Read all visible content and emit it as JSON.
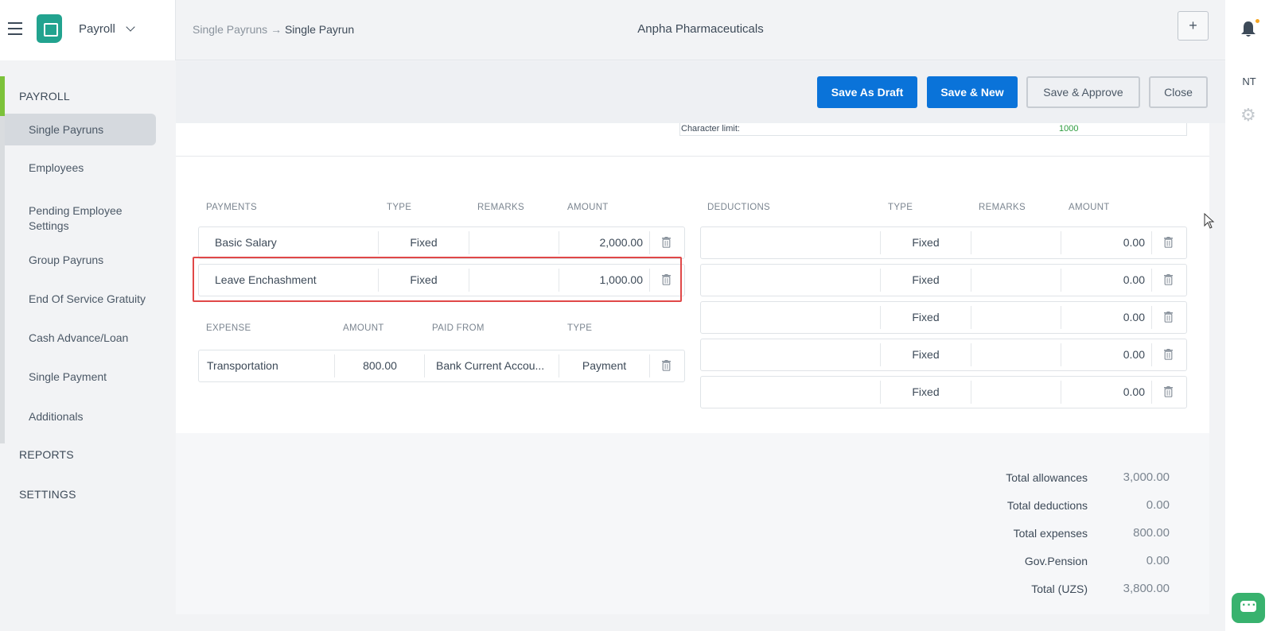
{
  "app": {
    "name": "Payroll"
  },
  "header": {
    "breadcrumb_parent": "Single Payruns",
    "breadcrumb_arrow": "→",
    "breadcrumb_current": "Single Payrun",
    "company": "Anpha Pharmaceuticals",
    "plus_label": "+"
  },
  "user": {
    "initials": "NT"
  },
  "sidebar": {
    "payroll_section": "PAYROLL",
    "items": [
      {
        "label": "Single Payruns"
      },
      {
        "label": "Employees"
      },
      {
        "label": "Pending Employee Settings"
      },
      {
        "label": "Group Payruns"
      },
      {
        "label": "End Of Service Gratuity"
      },
      {
        "label": "Cash Advance/Loan"
      },
      {
        "label": "Single Payment"
      },
      {
        "label": "Additionals"
      }
    ],
    "reports_section": "REPORTS",
    "settings_section": "SETTINGS"
  },
  "actions": {
    "save_draft": "Save As Draft",
    "save_new": "Save & New",
    "save_approve": "Save & Approve",
    "close": "Close"
  },
  "char_limit": {
    "label": "Character limit:",
    "value": "1000"
  },
  "payments": {
    "headers": {
      "name": "PAYMENTS",
      "type": "TYPE",
      "remarks": "REMARKS",
      "amount": "AMOUNT"
    },
    "rows": [
      {
        "name": "Basic Salary",
        "type": "Fixed",
        "remarks": "",
        "amount": "2,000.00"
      },
      {
        "name": "Leave Enchashment",
        "type": "Fixed",
        "remarks": "",
        "amount": "1,000.00"
      }
    ]
  },
  "expenses": {
    "headers": {
      "name": "EXPENSE",
      "amount": "AMOUNT",
      "paid_from": "PAID FROM",
      "type": "TYPE"
    },
    "rows": [
      {
        "name": "Transportation",
        "amount": "800.00",
        "paid_from": "Bank Current Accou...",
        "type": "Payment"
      }
    ]
  },
  "deductions": {
    "headers": {
      "name": "DEDUCTIONS",
      "type": "TYPE",
      "remarks": "REMARKS",
      "amount": "AMOUNT"
    },
    "rows": [
      {
        "name": "",
        "type": "Fixed",
        "remarks": "",
        "amount": "0.00"
      },
      {
        "name": "",
        "type": "Fixed",
        "remarks": "",
        "amount": "0.00"
      },
      {
        "name": "",
        "type": "Fixed",
        "remarks": "",
        "amount": "0.00"
      },
      {
        "name": "",
        "type": "Fixed",
        "remarks": "",
        "amount": "0.00"
      },
      {
        "name": "",
        "type": "Fixed",
        "remarks": "",
        "amount": "0.00"
      }
    ]
  },
  "totals": [
    {
      "label": "Total allowances",
      "value": "3,000.00"
    },
    {
      "label": "Total deductions",
      "value": "0.00"
    },
    {
      "label": "Total expenses",
      "value": "800.00"
    },
    {
      "label": "Gov.Pension",
      "value": "0.00"
    },
    {
      "label": "Total (UZS)",
      "value": "3,800.00"
    }
  ],
  "colors": {
    "primary": "#0a73d9",
    "brand": "#22a38f",
    "accent_green": "#7cc23a",
    "highlight_red": "#e04848",
    "notification": "#f6a623",
    "chat": "#38b26e"
  },
  "icons": [
    "menu-icon",
    "app-logo-icon",
    "chevron-down-icon",
    "plus-icon",
    "bell-icon",
    "gear-icon",
    "trash-icon",
    "chat-icon",
    "cursor-icon"
  ]
}
